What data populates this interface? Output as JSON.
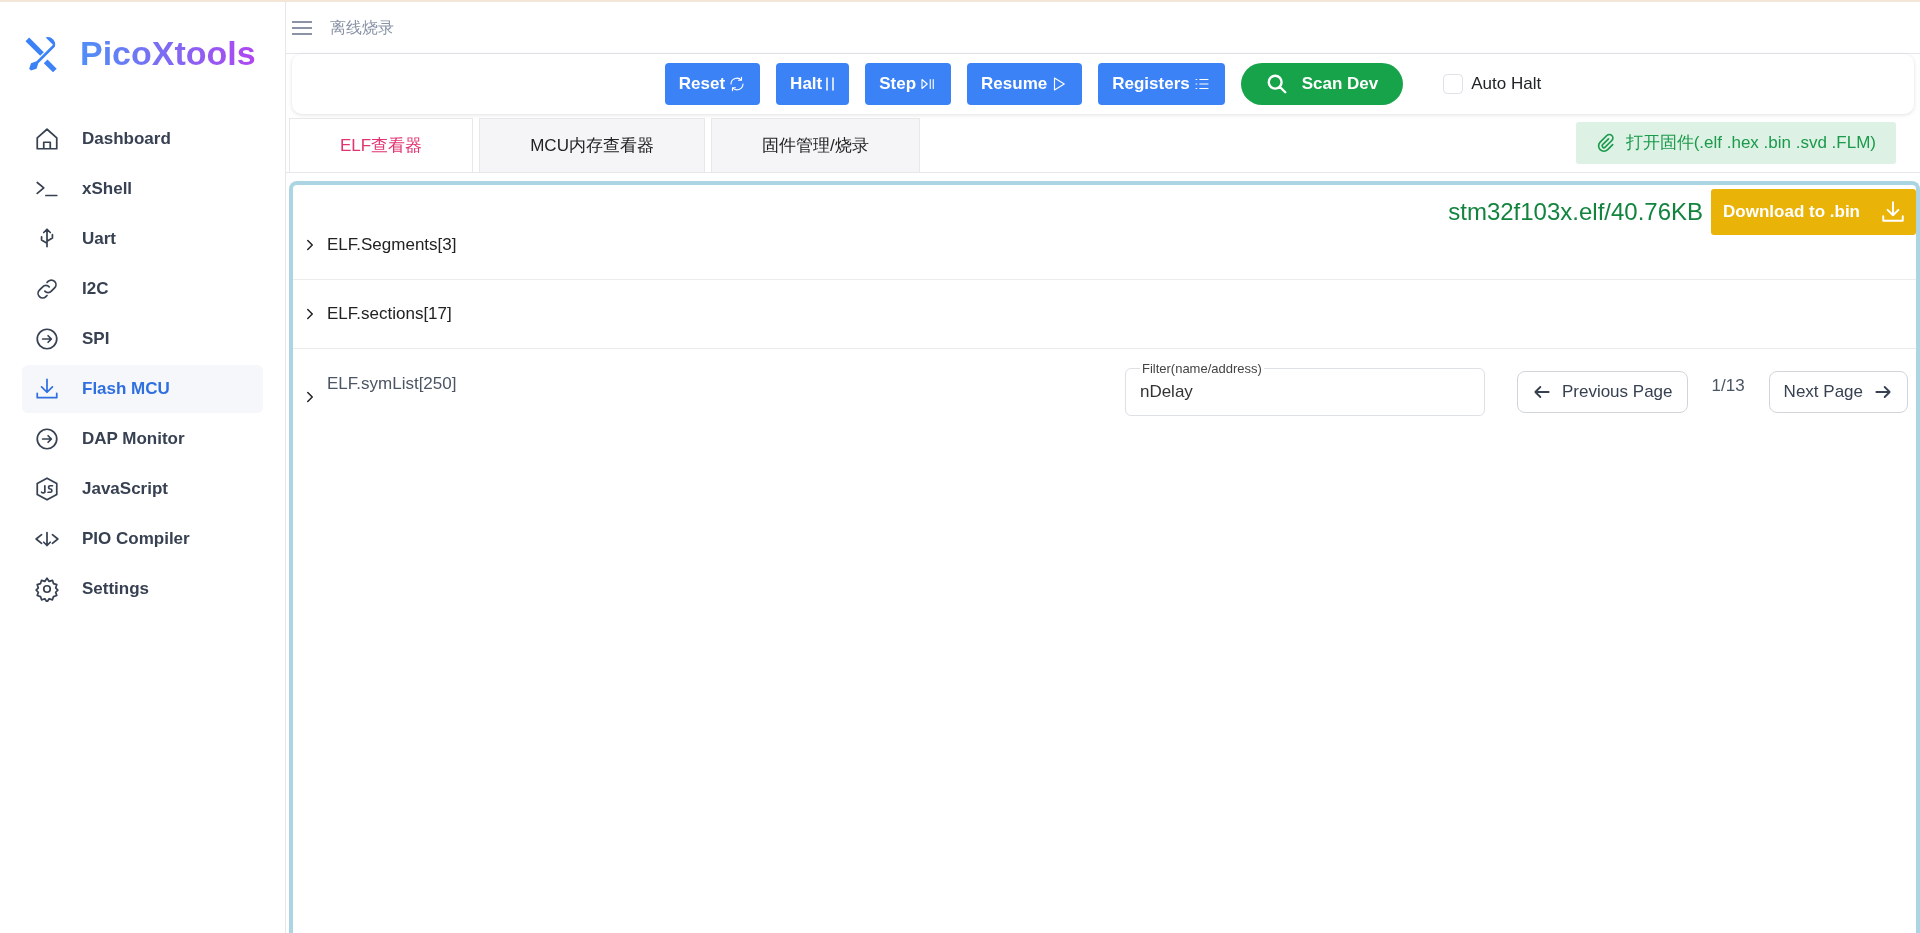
{
  "sidebar": {
    "logo": "PicoXtools",
    "items": [
      {
        "label": "Dashboard",
        "selected": false
      },
      {
        "label": "xShell",
        "selected": false
      },
      {
        "label": "Uart",
        "selected": false
      },
      {
        "label": "I2C",
        "selected": false
      },
      {
        "label": "SPI",
        "selected": false
      },
      {
        "label": "Flash MCU",
        "selected": true
      },
      {
        "label": "DAP Monitor",
        "selected": false
      },
      {
        "label": "JavaScript",
        "selected": false
      },
      {
        "label": "PIO Compiler",
        "selected": false
      },
      {
        "label": "Settings",
        "selected": false
      }
    ]
  },
  "header": {
    "title": "离线烧录"
  },
  "toolbar": {
    "buttons": [
      {
        "label": "Reset",
        "kind": "primary"
      },
      {
        "label": "Halt",
        "kind": "primary"
      },
      {
        "label": "Step",
        "kind": "primary"
      },
      {
        "label": "Resume",
        "kind": "primary"
      },
      {
        "label": "Registers",
        "kind": "primary"
      },
      {
        "label": "Scan Dev",
        "kind": "success"
      }
    ],
    "auto_halt": {
      "label": "Auto Halt",
      "checked": false
    }
  },
  "tabs": [
    {
      "label": "ELF查看器",
      "selected": true
    },
    {
      "label": "MCU内存查看器",
      "selected": false
    },
    {
      "label": "固件管理/烧录",
      "selected": false
    }
  ],
  "open_firmware": {
    "label": "打开固件(.elf .hex .bin .svd .FLM)"
  },
  "panel": {
    "file_info": "stm32f103x.elf/40.76KB",
    "download_button": "Download to .bin",
    "sections": [
      {
        "label": "ELF.Segments[3]",
        "expanded": false
      },
      {
        "label": "ELF.sections[17]",
        "expanded": false
      },
      {
        "label": "ELF.symList[250]",
        "expanded": false,
        "filter": {
          "label": "Filter(name/address)",
          "value": "nDelay"
        },
        "previous": "Previous Page",
        "page": "1/13",
        "next": "Next Page"
      }
    ]
  }
}
